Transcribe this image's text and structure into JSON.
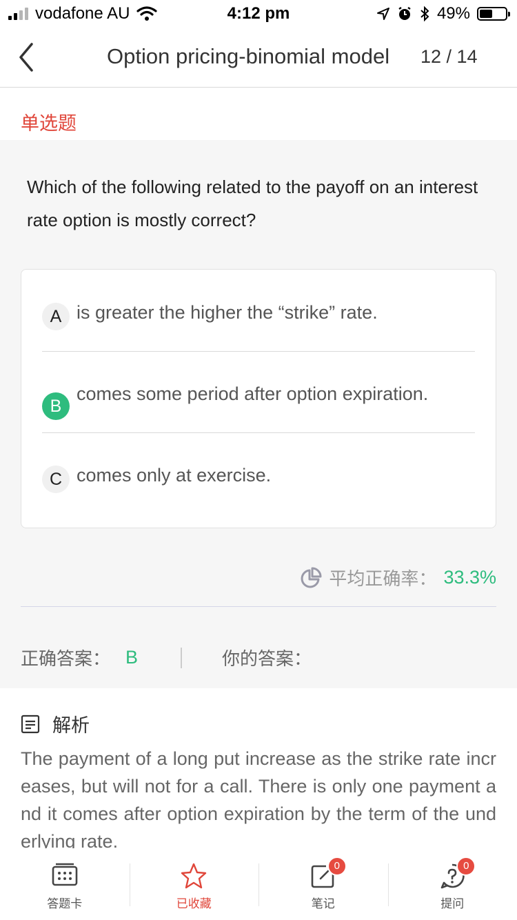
{
  "status_bar": {
    "carrier": "vodafone AU",
    "time": "4:12 pm",
    "battery": "49%",
    "battery_level": 0.49,
    "signal_bars": 2,
    "icons": [
      "signal-icon",
      "wifi-icon",
      "location-arrow-icon",
      "alarm-icon",
      "bluetooth-icon",
      "battery-icon"
    ]
  },
  "nav": {
    "title": "Option pricing-binomial model",
    "counter": "12 / 14",
    "back_icon": "chevron-left-icon"
  },
  "question": {
    "type": "单选题",
    "text": "Which of the following related to the payoff on an interest rate option is mostly correct?",
    "options": [
      {
        "letter": "A",
        "text": "is greater the higher the “strike” rate.",
        "is_correct": false
      },
      {
        "letter": "B",
        "text": "comes some period after option expiration.",
        "is_correct": true
      },
      {
        "letter": "C",
        "text": "comes only at exercise.",
        "is_correct": false
      }
    ]
  },
  "stats": {
    "avg_label": "平均正确率：",
    "avg_value": "33.3%",
    "icon": "pie-chart-icon"
  },
  "answers": {
    "correct_label": "正确答案：",
    "correct_value": "B",
    "yours_label": "你的答案：",
    "yours_value": ""
  },
  "analysis": {
    "title": "解析",
    "icon": "document-icon",
    "text": "The payment of a long put increase as the strike rate increases, but will not for a call. There is only one payment and it comes after option expiration by the term of the underlying rate."
  },
  "tabbar": {
    "items": [
      {
        "label": "答题卡",
        "icon": "answer-card-icon",
        "badge": null,
        "active": false
      },
      {
        "label": "已收藏",
        "icon": "star-icon",
        "badge": null,
        "active": true
      },
      {
        "label": "笔记",
        "icon": "note-edit-icon",
        "badge": "0",
        "active": false
      },
      {
        "label": "提问",
        "icon": "question-bubble-icon",
        "badge": "0",
        "active": false
      }
    ]
  },
  "colors": {
    "accent_red": "#e0463a",
    "correct_green": "#2ebc7e",
    "badge_red": "#e64b40"
  }
}
